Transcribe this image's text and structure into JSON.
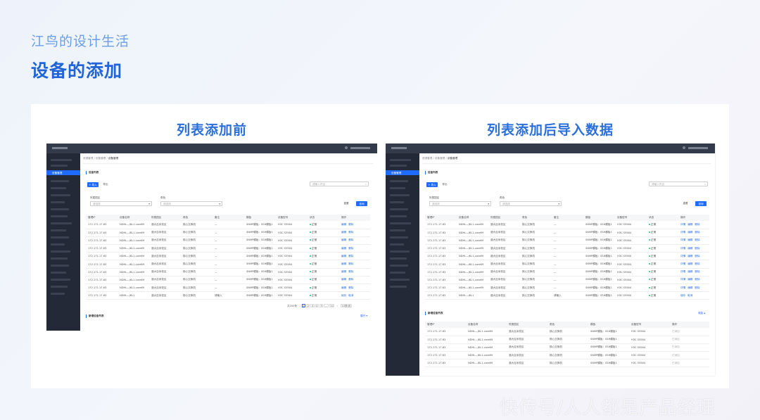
{
  "header": {
    "subtitle": "江鸟的设计生活",
    "title": "设备的添加"
  },
  "left_panel": {
    "title": "列表添加前",
    "sidebar_active": "设备管理",
    "breadcrumb": [
      "资源管理",
      "/",
      "设备管理",
      "/",
      "设备管理"
    ],
    "section_title": "设备列表",
    "import_button": "+ 导入",
    "export_button": "导出",
    "search_placeholder": "请输入内容",
    "filter1_label": "所属园区",
    "filter1_placeholder": "请选择",
    "filter2_label": "角色",
    "filter2_placeholder": "请选择",
    "reset_button": "重置",
    "query_button": "查询",
    "columns": [
      "管理IP",
      "设备名称",
      "所属园区",
      "角色",
      "备注",
      "模板",
      "设备型号",
      "状态",
      "操作"
    ],
    "rows": [
      [
        "172.171.17.63",
        "NDHL—JKL1-core69",
        "澳大百米校区",
        "核心交换机",
        "—",
        "SNMP模板：SSH模板1",
        "H3C S5564",
        "正常",
        "编辑",
        "删除"
      ],
      [
        "172.171.17.63",
        "NDHL—JKL1-core69",
        "澳大百米校区",
        "核心交换机",
        "—",
        "SNMP模板：SSH模板1",
        "H3C S5564",
        "正常",
        "编辑",
        "删除"
      ],
      [
        "172.171.17.63",
        "NDHL—JKL1-core69",
        "澳大百米校区",
        "核心交换机",
        "—",
        "SNMP模板：SSH模板1",
        "H3C S5564",
        "正常",
        "编辑",
        "删除"
      ],
      [
        "172.171.17.63",
        "NDHL—JKL1-core69",
        "澳大百米校区",
        "核心交换机",
        "—",
        "SNMP模板：SSH模板1",
        "H3C S5564",
        "正常",
        "编辑",
        "删除"
      ],
      [
        "172.171.17.63",
        "NDHL—JKL1-core69",
        "澳大百米校区",
        "核心交换机",
        "—",
        "SNMP模板：SSH模板1",
        "H3C S5564",
        "正常",
        "编辑",
        "删除"
      ],
      [
        "172.171.17.63",
        "NDHL—JKL1-core69",
        "澳大百米校区",
        "核心交换机",
        "—",
        "SNMP模板：SSH模板1",
        "H3C S5564",
        "正常",
        "编辑",
        "删除"
      ],
      [
        "172.171.17.63",
        "NDHL—JKL1-core69",
        "澳大百米校区",
        "核心交换机",
        "—",
        "SNMP模板：SSH模板1",
        "H3C S5564",
        "正常",
        "编辑",
        "删除"
      ],
      [
        "172.171.17.63",
        "NDHL—JKL1-core69",
        "澳大百米校区",
        "核心交换机",
        "—",
        "SNMP模板：SSH模板1",
        "H3C S5564",
        "正常",
        "编辑",
        "删除"
      ],
      [
        "172.171.17.63",
        "NDHL—JKL1-core69",
        "澳大百米校区",
        "核心交换机",
        "—",
        "SNMP模板：SSH模板1",
        "H3C S5564",
        "正常",
        "编辑",
        "删除"
      ],
      [
        "172.171.17.63",
        "NDHL—JKL1",
        "澳大百米校区",
        "核心交换机",
        "请输入",
        "SNMP模板：SSH模板1",
        "H3C S5564",
        "正常",
        "保存",
        "取消"
      ]
    ],
    "pager": {
      "total": "共200条",
      "pages": [
        "1",
        "2",
        "3",
        "4",
        "5",
        "...",
        "10"
      ],
      "size": "10条/页"
    },
    "new_section_title": "新增设备列表",
    "new_link": "展开"
  },
  "right_panel": {
    "title": "列表添加后导入数据",
    "sidebar_active": "设备管理",
    "breadcrumb": [
      "资源管理",
      "/",
      "设备管理",
      "/",
      "设备管理"
    ],
    "section_title": "设备列表",
    "import_button": "+ 导入",
    "export_button": "导出",
    "search_placeholder": "请输入内容",
    "filter1_label": "所属园区",
    "filter1_placeholder": "请选择",
    "filter2_label": "角色",
    "filter2_placeholder": "请选择",
    "reset_button": "重置",
    "query_button": "查询",
    "columns": [
      "管理IP",
      "设备名称",
      "所属园区",
      "角色",
      "备注",
      "模板",
      "设备型号",
      "状态",
      "操作"
    ],
    "rows": [
      [
        "172.171.17.63",
        "NDHL—JKL1-core69",
        "澳大百米校区",
        "核心交换机",
        "—",
        "SNMP模板：SSH模板1",
        "H3C S5564",
        "正常",
        "详情",
        "编辑",
        "删除"
      ],
      [
        "172.171.17.63",
        "NDHL—JKL1-core69",
        "澳大百米校区",
        "核心交换机",
        "—",
        "SNMP模板：SSH模板1",
        "H3C S5564",
        "正常",
        "详情",
        "编辑",
        "删除"
      ],
      [
        "172.171.17.63",
        "NDHL—JKL1-core69",
        "澳大百米校区",
        "核心交换机",
        "—",
        "SNMP模板：SSH模板1",
        "H3C S5564",
        "正常",
        "详情",
        "编辑",
        "删除"
      ],
      [
        "172.171.17.63",
        "NDHL—JKL1-core69",
        "澳大百米校区",
        "核心交换机",
        "—",
        "SNMP模板：SSH模板1",
        "H3C S5564",
        "正常",
        "详情",
        "编辑",
        "删除"
      ],
      [
        "172.171.17.63",
        "NDHL—JKL1-core69",
        "澳大百米校区",
        "核心交换机",
        "—",
        "SNMP模板：SSH模板1",
        "H3C S5564",
        "正常",
        "详情",
        "编辑",
        "删除"
      ],
      [
        "172.171.17.63",
        "NDHL—JKL1-core69",
        "澳大百米校区",
        "核心交换机",
        "—",
        "SNMP模板：SSH模板1",
        "H3C S5564",
        "正常",
        "详情",
        "编辑",
        "删除"
      ],
      [
        "172.171.17.63",
        "NDHL—JKL1-core69",
        "澳大百米校区",
        "核心交换机",
        "—",
        "SNMP模板：SSH模板1",
        "H3C S5564",
        "正常",
        "详情",
        "编辑",
        "删除"
      ],
      [
        "172.171.17.63",
        "NDHL—JKL1-core69",
        "澳大百米校区",
        "核心交换机",
        "—",
        "SNMP模板：SSH模板1",
        "H3C S5564",
        "正常",
        "详情",
        "编辑",
        "删除"
      ],
      [
        "172.171.17.63",
        "NDHL—JKL1-core69",
        "澳大百米校区",
        "核心交换机",
        "—",
        "SNMP模板：SSH模板1",
        "H3C S5564",
        "正常",
        "详情",
        "编辑",
        "删除"
      ],
      [
        "172.171.17.63",
        "NDHL—JKL1",
        "澳大百米校区",
        "核心交换机",
        "请输入",
        "SNMP模板：SSH模板1",
        "H3C S5564",
        "正常",
        "保存",
        "取消",
        ""
      ]
    ],
    "new_section_title": "新增设备列表",
    "new_link": "收起",
    "new_columns": [
      "管理IP",
      "设备名称",
      "所属园区",
      "角色",
      "模板",
      "设备型号",
      "操作"
    ],
    "new_rows": [
      [
        "172.171.17.63",
        "NDHL—JKL1-core69",
        "澳大百米校区",
        "核心交换机",
        "SNMP模板：SSH模板1",
        "H3C S5564",
        "已添加"
      ],
      [
        "172.171.17.63",
        "NDHL—JKL1-core69",
        "澳大百米校区",
        "核心交换机",
        "SNMP模板：SSH模板1",
        "H3C S5564",
        "已添加"
      ],
      [
        "172.171.17.63",
        "NDHL—JKL1-core69",
        "澳大百米校区",
        "核心交换机",
        "SNMP模板：SSH模板1",
        "H3C S5564",
        "已添加"
      ],
      [
        "172.171.17.63",
        "NDHL—JKL1-core69",
        "澳大百米校区",
        "核心交换机",
        "SNMP模板：SSH模板1",
        "H3C S5564",
        "已添加"
      ],
      [
        "172.171.17.63",
        "NDHL—JKL1-core69",
        "澳大百米校区",
        "核心交换机",
        "SNMP模板：SSH模板1",
        "H3C S5564",
        "已添加"
      ]
    ]
  },
  "watermark": "快传号/人人都是产品经理",
  "colors": {
    "accent": "#1f6bff",
    "title": "#1f64d8",
    "sidebar": "#232937",
    "topbar": "#333b4a",
    "status_ok": "#1dbf73"
  }
}
